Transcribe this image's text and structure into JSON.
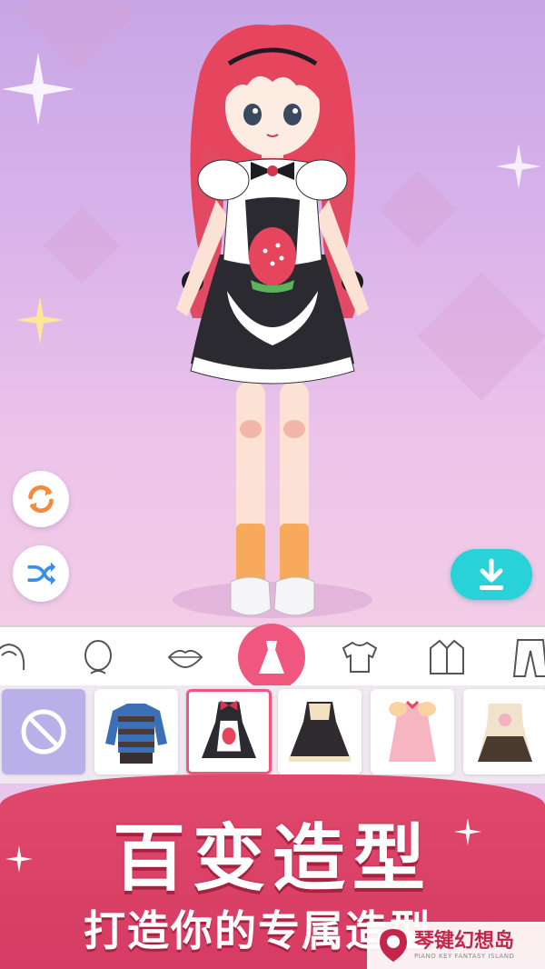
{
  "colors": {
    "accent": "#f0577f",
    "banner": "#d63c63",
    "download": "#28d2d8",
    "none_tile": "#b9b0ea"
  },
  "controls": {
    "rotate_icon": "rotate-arrows-icon",
    "shuffle_icon": "shuffle-icon",
    "download_icon": "download-icon"
  },
  "categories": [
    {
      "name": "hair",
      "icon": "hair-icon",
      "active": false
    },
    {
      "name": "face",
      "icon": "face-icon",
      "active": false
    },
    {
      "name": "lips",
      "icon": "lips-icon",
      "active": false
    },
    {
      "name": "dress",
      "icon": "dress-icon",
      "active": true
    },
    {
      "name": "top",
      "icon": "top-icon",
      "active": false
    },
    {
      "name": "jacket",
      "icon": "jacket-icon",
      "active": false
    },
    {
      "name": "pants",
      "icon": "pants-icon",
      "active": false
    }
  ],
  "items": [
    {
      "name": "none",
      "selected": false
    },
    {
      "name": "striped-sweater",
      "selected": false
    },
    {
      "name": "maid-dress",
      "selected": true
    },
    {
      "name": "black-lolita-dress",
      "selected": false
    },
    {
      "name": "pink-dress",
      "selected": false
    },
    {
      "name": "cream-dress",
      "selected": false
    }
  ],
  "banner": {
    "headline": "百变造型",
    "subline": "打造你的专属造型"
  },
  "watermark": {
    "title": "琴键幻想岛",
    "subtitle": "PIANO KEY FANTASY ISLAND"
  }
}
